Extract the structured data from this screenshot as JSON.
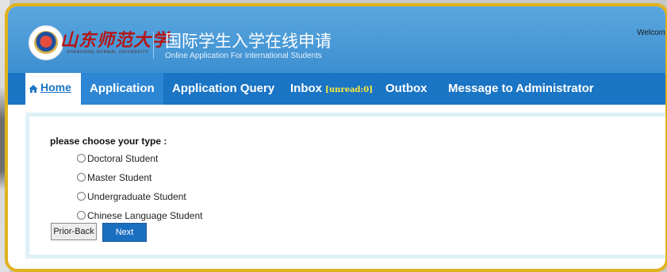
{
  "header": {
    "logo_cn": "山东师范大学",
    "logo_en": "SHANDONG NORMAL UNIVERSITY",
    "title_cn": "国际学生入学在线申请",
    "title_en": "Online Application For International Students",
    "welcome": "Welcom"
  },
  "nav": {
    "home": "Home",
    "application": "Application",
    "application_query": "Application Query",
    "inbox": "Inbox",
    "unread": "[unread:0]",
    "outbox": "Outbox",
    "message_admin": "Message to Administrator"
  },
  "form": {
    "prompt": "please choose your type :",
    "options": [
      "Doctoral Student",
      "Master Student",
      "Undergraduate Student",
      "Chinese Language Student"
    ],
    "prior_back": "Prior-Back",
    "next": "Next"
  },
  "colors": {
    "nav": "#1b75c5",
    "header": "#4a9ad8",
    "frame": "#e0b21d",
    "unread": "#ffeb3b"
  }
}
